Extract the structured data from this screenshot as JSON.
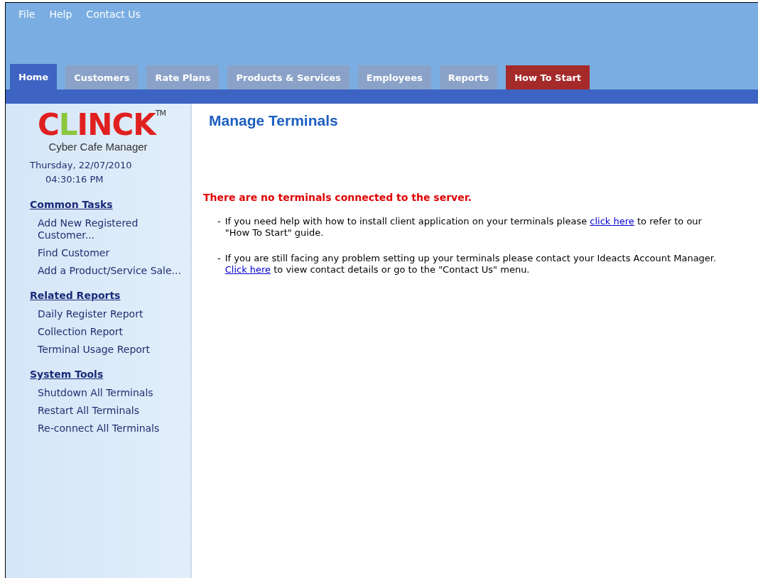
{
  "menu": [
    "File",
    "Help",
    "Contact Us"
  ],
  "tabs": [
    {
      "label": "Home",
      "selected": true,
      "kind": "normal"
    },
    {
      "label": "Customers",
      "selected": false,
      "kind": "normal"
    },
    {
      "label": "Rate Plans",
      "selected": false,
      "kind": "normal"
    },
    {
      "label": "Products & Services",
      "selected": false,
      "kind": "normal"
    },
    {
      "label": "Employees",
      "selected": false,
      "kind": "normal"
    },
    {
      "label": "Reports",
      "selected": false,
      "kind": "normal"
    },
    {
      "label": "How To Start",
      "selected": false,
      "kind": "highlight"
    }
  ],
  "sidebar": {
    "logo": {
      "parts": [
        {
          "text": "C",
          "color": "#e02020"
        },
        {
          "text": "L",
          "color": "#8cc63f"
        },
        {
          "text": "INCK",
          "color": "#e02020"
        }
      ],
      "mark": "TM",
      "subtitle": "Cyber Cafe Manager"
    },
    "date": "Thursday, 22/07/2010",
    "time": "04:30:16 PM",
    "sections": [
      {
        "title": "Common Tasks",
        "items": [
          "Add New Registered Customer...",
          "Find Customer",
          "Add a Product/Service Sale..."
        ]
      },
      {
        "title": "Related Reports",
        "items": [
          "Daily Register Report",
          "Collection Report",
          "Terminal Usage Report"
        ]
      },
      {
        "title": "System Tools",
        "items": [
          "Shutdown All Terminals",
          "Restart All Terminals",
          "Re-connect All Terminals"
        ]
      }
    ]
  },
  "main": {
    "title": "Manage Terminals",
    "alert": "There are no terminals connected to the server.",
    "notes": [
      {
        "dash": "-",
        "before": "If you need help with how to install client application on your terminals please ",
        "link": "click here",
        "after": " to refer to our \"How To Start\" guide."
      },
      {
        "dash": "-",
        "before": "If you are still facing any problem setting up your terminals please contact your Ideacts Account Manager. ",
        "link": "Click here",
        "after": " to view contact details or go to the \"Contact Us\" menu."
      }
    ]
  }
}
